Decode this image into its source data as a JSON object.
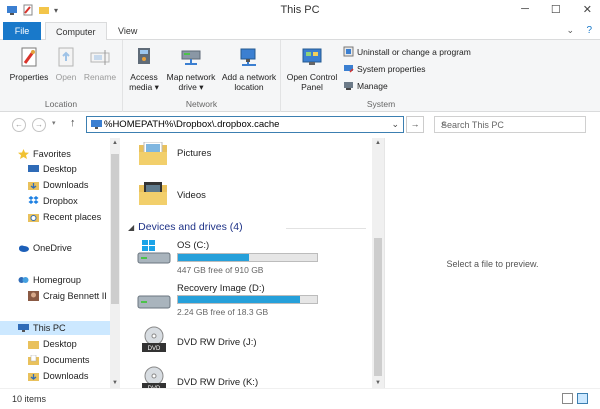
{
  "window": {
    "title": "This PC",
    "minimize": "─",
    "maximize": "☐",
    "close": "✕"
  },
  "tabs": {
    "file": "File",
    "computer": "Computer",
    "view": "View",
    "collapse": "⌄",
    "help": "?"
  },
  "ribbon": {
    "location": {
      "label": "Location",
      "properties": "Properties",
      "open": "Open",
      "rename": "Rename"
    },
    "network": {
      "label": "Network",
      "access_media_1": "Access",
      "access_media_2": "media ▾",
      "map_drive_1": "Map network",
      "map_drive_2": "drive ▾",
      "add_location_1": "Add a network",
      "add_location_2": "location"
    },
    "system": {
      "label": "System",
      "control_panel_1": "Open Control",
      "control_panel_2": "Panel",
      "uninstall": "Uninstall or change a program",
      "properties": "System properties",
      "manage": "Manage"
    }
  },
  "address": {
    "back": "←",
    "forward": "→",
    "up": "↑",
    "path": "%HOMEPATH%\\Dropbox\\.dropbox.cache",
    "dropdown": "⌄",
    "go": "→",
    "search_placeholder": "Search This PC",
    "search_icon": "⌕"
  },
  "nav": {
    "favorites": "Favorites",
    "desktop": "Desktop",
    "downloads": "Downloads",
    "dropbox": "Dropbox",
    "recent": "Recent places",
    "onedrive": "OneDrive",
    "homegroup": "Homegroup",
    "user": "Craig Bennett II",
    "thispc": "This PC",
    "pc_desktop": "Desktop",
    "pc_documents": "Documents",
    "pc_downloads": "Downloads"
  },
  "content": {
    "folders": [
      "Pictures",
      "Videos"
    ],
    "section": "Devices and drives (4)",
    "drives": [
      {
        "name": "OS (C:)",
        "free": "447 GB free of 910 GB",
        "used_fraction": 0.51
      },
      {
        "name": "Recovery Image (D:)",
        "free": "2.24 GB free of 18.3 GB",
        "used_fraction": 0.88
      },
      {
        "name": "DVD RW Drive (J:)"
      },
      {
        "name": "DVD RW Drive (K:)"
      }
    ]
  },
  "preview": {
    "message": "Select a file to preview."
  },
  "status": {
    "count": "10 items"
  },
  "colors": {
    "accent": "#1979ca",
    "drive_bar": "#26a0da",
    "selection": "#cce8ff"
  }
}
